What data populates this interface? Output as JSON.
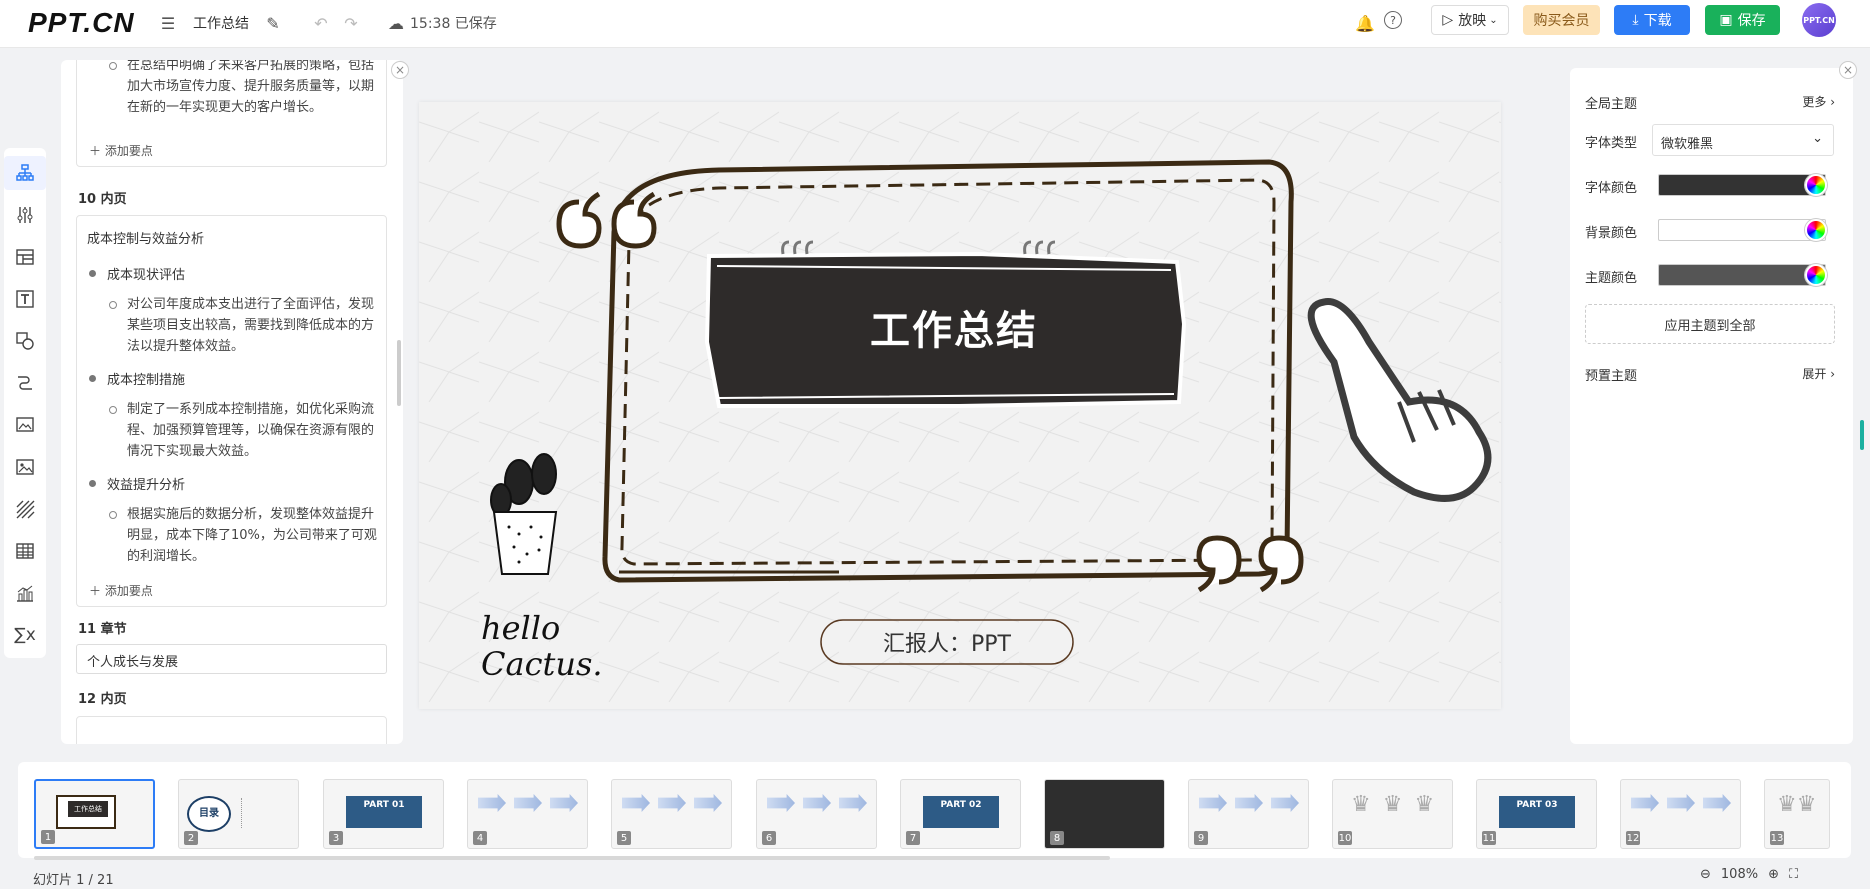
{
  "header": {
    "logo": "PPT.CN",
    "doc_title": "工作总结",
    "save_status": "15:38 已保存",
    "play_label": "放映",
    "vip_label": "购买会员",
    "download_label": "下载",
    "save_label": "保存",
    "avatar_text": "PPT.CN"
  },
  "outline": {
    "top_card": {
      "sub": "在总结中明确了未来客户拓展的策略，包括加大市场宣传力度、提升服务质量等，以期在新的一年实现更大的客户增长。",
      "add": "添加要点"
    },
    "sec10": {
      "label": "10 内页",
      "title": "成本控制与效益分析",
      "b1": "成本现状评估",
      "b1_sub": "对公司年度成本支出进行了全面评估，发现某些项目支出较高，需要找到降低成本的方法以提升整体效益。",
      "b2": "成本控制措施",
      "b2_sub": "制定了一系列成本控制措施，如优化采购流程、加强预算管理等，以确保在资源有限的情况下实现最大效益。",
      "b3": "效益提升分析",
      "b3_sub": "根据实施后的数据分析，发现整体效益提升明显，成本下降了10%，为公司带来了可观的利润增长。",
      "add": "添加要点"
    },
    "sec11": {
      "label": "11 章节",
      "value": "个人成长与发展"
    },
    "sec12": {
      "label": "12 内页"
    }
  },
  "slide": {
    "title": "工作总结",
    "reporter": "汇报人：PPT",
    "hello_line1": "hello",
    "hello_line2": "Cactus."
  },
  "theme_panel": {
    "global_theme": "全局主题",
    "more": "更多",
    "font_type_label": "字体类型",
    "font_type_value": "微软雅黑",
    "font_color_label": "字体颜色",
    "font_color": "#333333",
    "bg_color_label": "背景颜色",
    "bg_color": "#ffffff",
    "theme_color_label": "主题颜色",
    "theme_color": "#555555",
    "apply_all": "应用主题到全部",
    "preset_label": "预置主题",
    "expand": "展开"
  },
  "thumbnails": [
    {
      "num": "1",
      "type": "cover"
    },
    {
      "num": "2",
      "type": "toc",
      "text": "目录"
    },
    {
      "num": "3",
      "type": "part",
      "text": "PART 01"
    },
    {
      "num": "4",
      "type": "arrows"
    },
    {
      "num": "5",
      "type": "arrows"
    },
    {
      "num": "6",
      "type": "arrows"
    },
    {
      "num": "7",
      "type": "part",
      "text": "PART 02"
    },
    {
      "num": "8",
      "type": "dark"
    },
    {
      "num": "9",
      "type": "arrows"
    },
    {
      "num": "10",
      "type": "trophy"
    },
    {
      "num": "11",
      "type": "part",
      "text": "PART 03"
    },
    {
      "num": "12",
      "type": "arrows"
    },
    {
      "num": "13",
      "type": "trophy"
    }
  ],
  "footer": {
    "slide_count": "幻灯片 1 / 21",
    "zoom": "108%"
  }
}
